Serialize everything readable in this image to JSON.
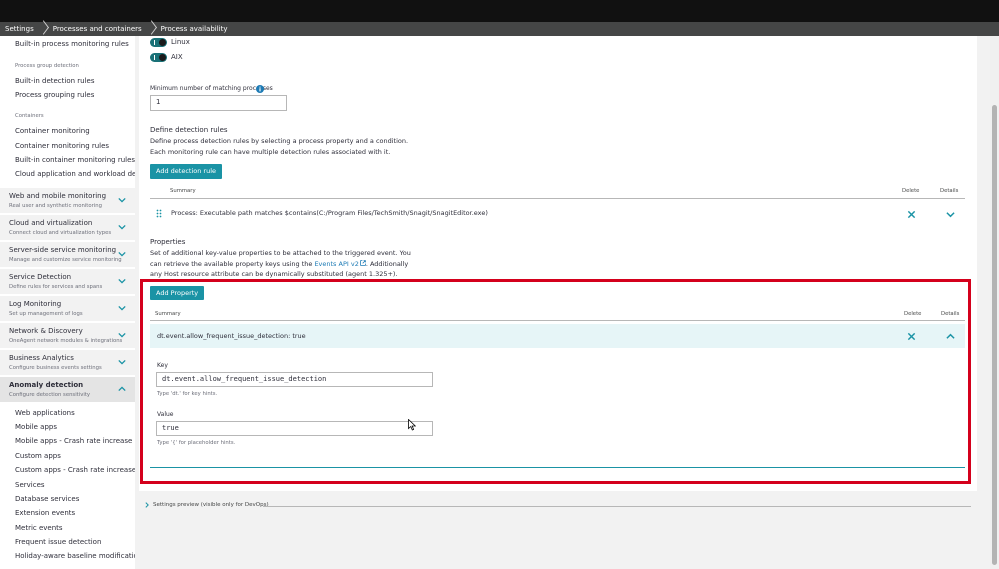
{
  "breadcrumb": [
    "Settings",
    "Processes and containers",
    "Process availability"
  ],
  "sidebar": {
    "top_links": [
      {
        "label": "Built-in process monitoring rules"
      }
    ],
    "groups": [
      {
        "title": "Process group detection",
        "items": [
          "Built-in detection rules",
          "Process grouping rules"
        ]
      },
      {
        "title": "Containers",
        "items": [
          "Container monitoring",
          "Container monitoring rules",
          "Built-in container monitoring rules",
          "Cloud application and workload detec..."
        ]
      }
    ],
    "sections": [
      {
        "title": "Web and mobile monitoring",
        "subtitle": "Real user and synthetic monitoring"
      },
      {
        "title": "Cloud and virtualization",
        "subtitle": "Connect cloud and virtualization types"
      },
      {
        "title": "Server-side service monitoring",
        "subtitle": "Manage and customize service monitoring"
      },
      {
        "title": "Service Detection",
        "subtitle": "Define rules for services and spans"
      },
      {
        "title": "Log Monitoring",
        "subtitle": "Set up management of logs"
      },
      {
        "title": "Network & Discovery",
        "subtitle": "OneAgent network modules & integrations"
      },
      {
        "title": "Business Analytics",
        "subtitle": "Configure business events settings"
      },
      {
        "title": "Anomaly detection",
        "subtitle": "Configure detection sensitivity"
      }
    ],
    "anomaly_items": [
      "Web applications",
      "Mobile apps",
      "Mobile apps - Crash rate increase",
      "Custom apps",
      "Custom apps - Crash rate increase",
      "Services",
      "Database services",
      "Extension events",
      "Metric events",
      "Frequent issue detection",
      "Holiday-aware baseline modification"
    ]
  },
  "os_toggles": [
    {
      "label": "Linux",
      "on": true
    },
    {
      "label": "AIX",
      "on": true
    }
  ],
  "min_matching": {
    "label": "Minimum number of matching processes",
    "value": "1"
  },
  "detection_rules": {
    "title": "Define detection rules",
    "description": "Define process detection rules by selecting a process property and a condition. Each monitoring rule can have multiple detection rules associated with it.",
    "add_label": "Add detection rule",
    "col_summary": "Summary",
    "col_delete": "Delete",
    "col_details": "Details",
    "rows": [
      {
        "summary": "Process: Executable path matches $contains(C:/Program Files/TechSmith/Snagit/SnagitEditor.exe)"
      }
    ]
  },
  "properties": {
    "title": "Properties",
    "desc_part1": "Set of additional key-value properties to be attached to the triggered event. You can retrieve the available property keys using the ",
    "desc_link": "Events API v2",
    "desc_part2": ". Additionally any Host resource attribute can be dynamically substituted (agent 1.325+).",
    "add_label": "Add Property",
    "col_summary": "Summary",
    "col_delete": "Delete",
    "col_details": "Details",
    "row_summary": "dt.event.allow_frequent_issue_detection: true",
    "key_label": "Key",
    "key_value": "dt.event.allow_frequent_issue_detection",
    "key_hint": "Type 'dt.' for key hints.",
    "value_label": "Value",
    "value_value": "true",
    "value_hint": "Type '{' for placeholder hints."
  },
  "settings_preview": "Settings preview (visible only for DevOps)",
  "colors": {
    "accent": "#1a93a5",
    "highlight": "#d4001c",
    "toggle": "#1a7177"
  }
}
